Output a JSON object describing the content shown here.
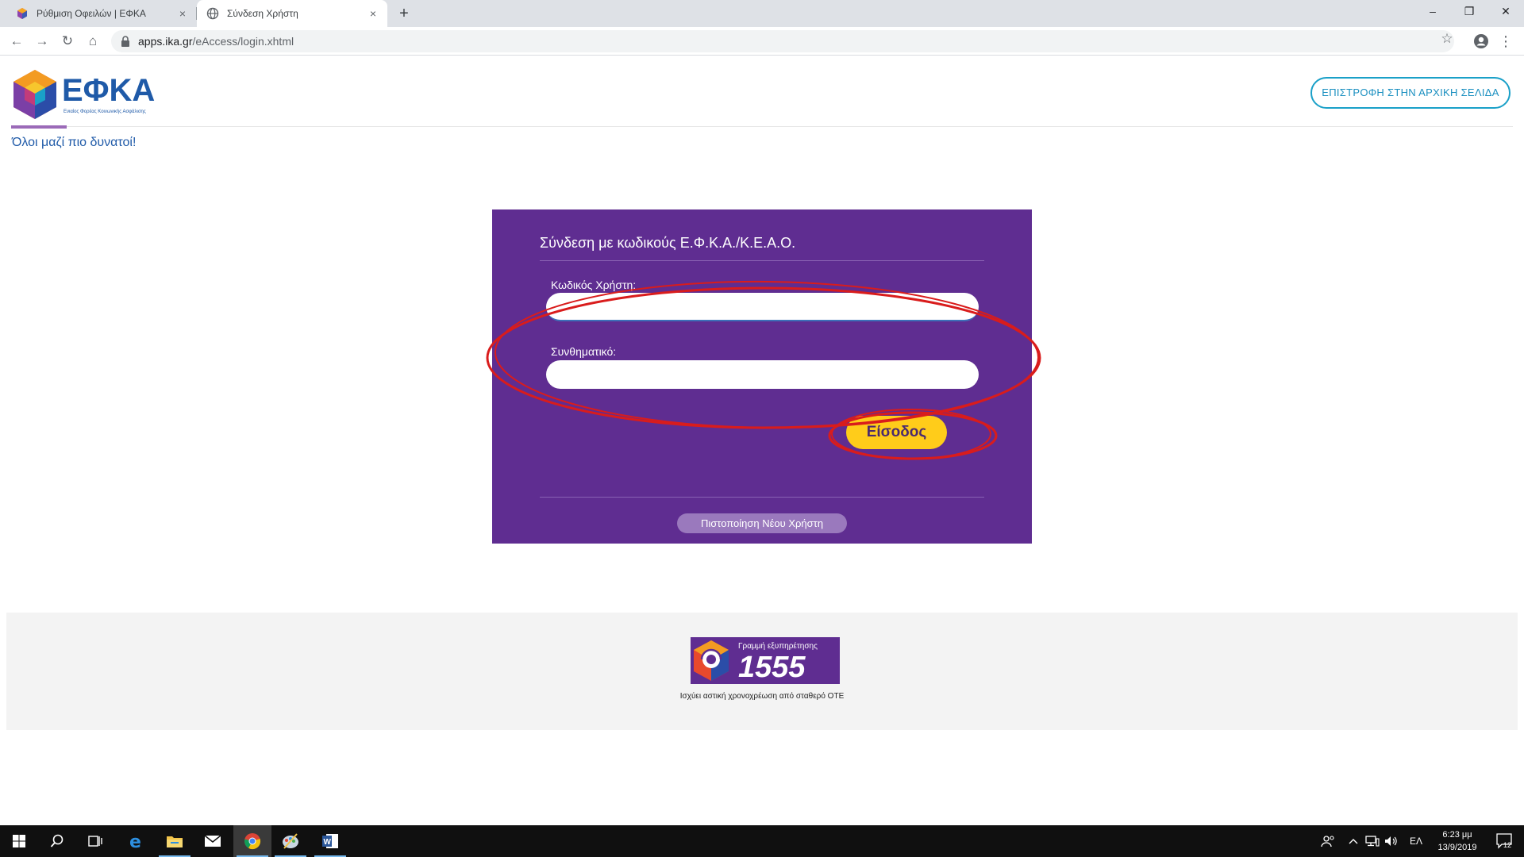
{
  "browser": {
    "tabs": [
      {
        "title": "Ρύθμιση Οφειλών | ΕΦΚΑ",
        "close": "×"
      },
      {
        "title": "Σύνδεση Χρήστη",
        "close": "×"
      }
    ],
    "new_tab": "+",
    "window_controls": {
      "minimize": "–",
      "maximize": "❐",
      "close": "✕"
    },
    "nav": {
      "back": "←",
      "forward": "→",
      "reload": "↻",
      "home": "⌂"
    },
    "url_host": "apps.ika.gr",
    "url_path": "/eAccess/login.xhtml",
    "bookmark": "☆",
    "menu": "⋮"
  },
  "header": {
    "logo_text": "ΕΦΚΑ",
    "logo_subtitle": "Ενιαίος Φορέας Κοινωνικής Ασφάλισης",
    "return_button": "ΕΠΙΣΤΡΟΦΗ ΣΤΗΝ ΑΡΧΙΚΗ ΣΕΛΙΔΑ",
    "slogan": "Όλοι μαζί πιο δυνατοί!",
    "accent_color": "#9b6ab8"
  },
  "login": {
    "title": "Σύνδεση με κωδικούς Ε.Φ.Κ.Α./Κ.Ε.Α.Ο.",
    "username_label": "Κωδικός Χρήστη:",
    "username_value": "",
    "password_label": "Συνθηματικό:",
    "password_value": "",
    "submit_button": "Είσοδος",
    "new_user_button": "Πιστοποίηση Νέου Χρήστη",
    "card_color": "#5f2d91",
    "button_color": "#ffcc1a"
  },
  "footer": {
    "hotline_label": "Γραμμή εξυπηρέτησης",
    "hotline_number": "1555",
    "hotline_note": "Ισχύει αστική χρονοχρέωση από σταθερό ΟΤΕ"
  },
  "taskbar": {
    "icons": [
      "windows-start-icon",
      "search-icon",
      "task-view-icon",
      "edge-icon",
      "file-explorer-icon",
      "mail-icon",
      "chrome-icon",
      "paint-icon",
      "word-icon"
    ],
    "language": "ΕΛ",
    "time": "6:23 μμ",
    "date": "13/9/2019",
    "notifications": "12"
  }
}
